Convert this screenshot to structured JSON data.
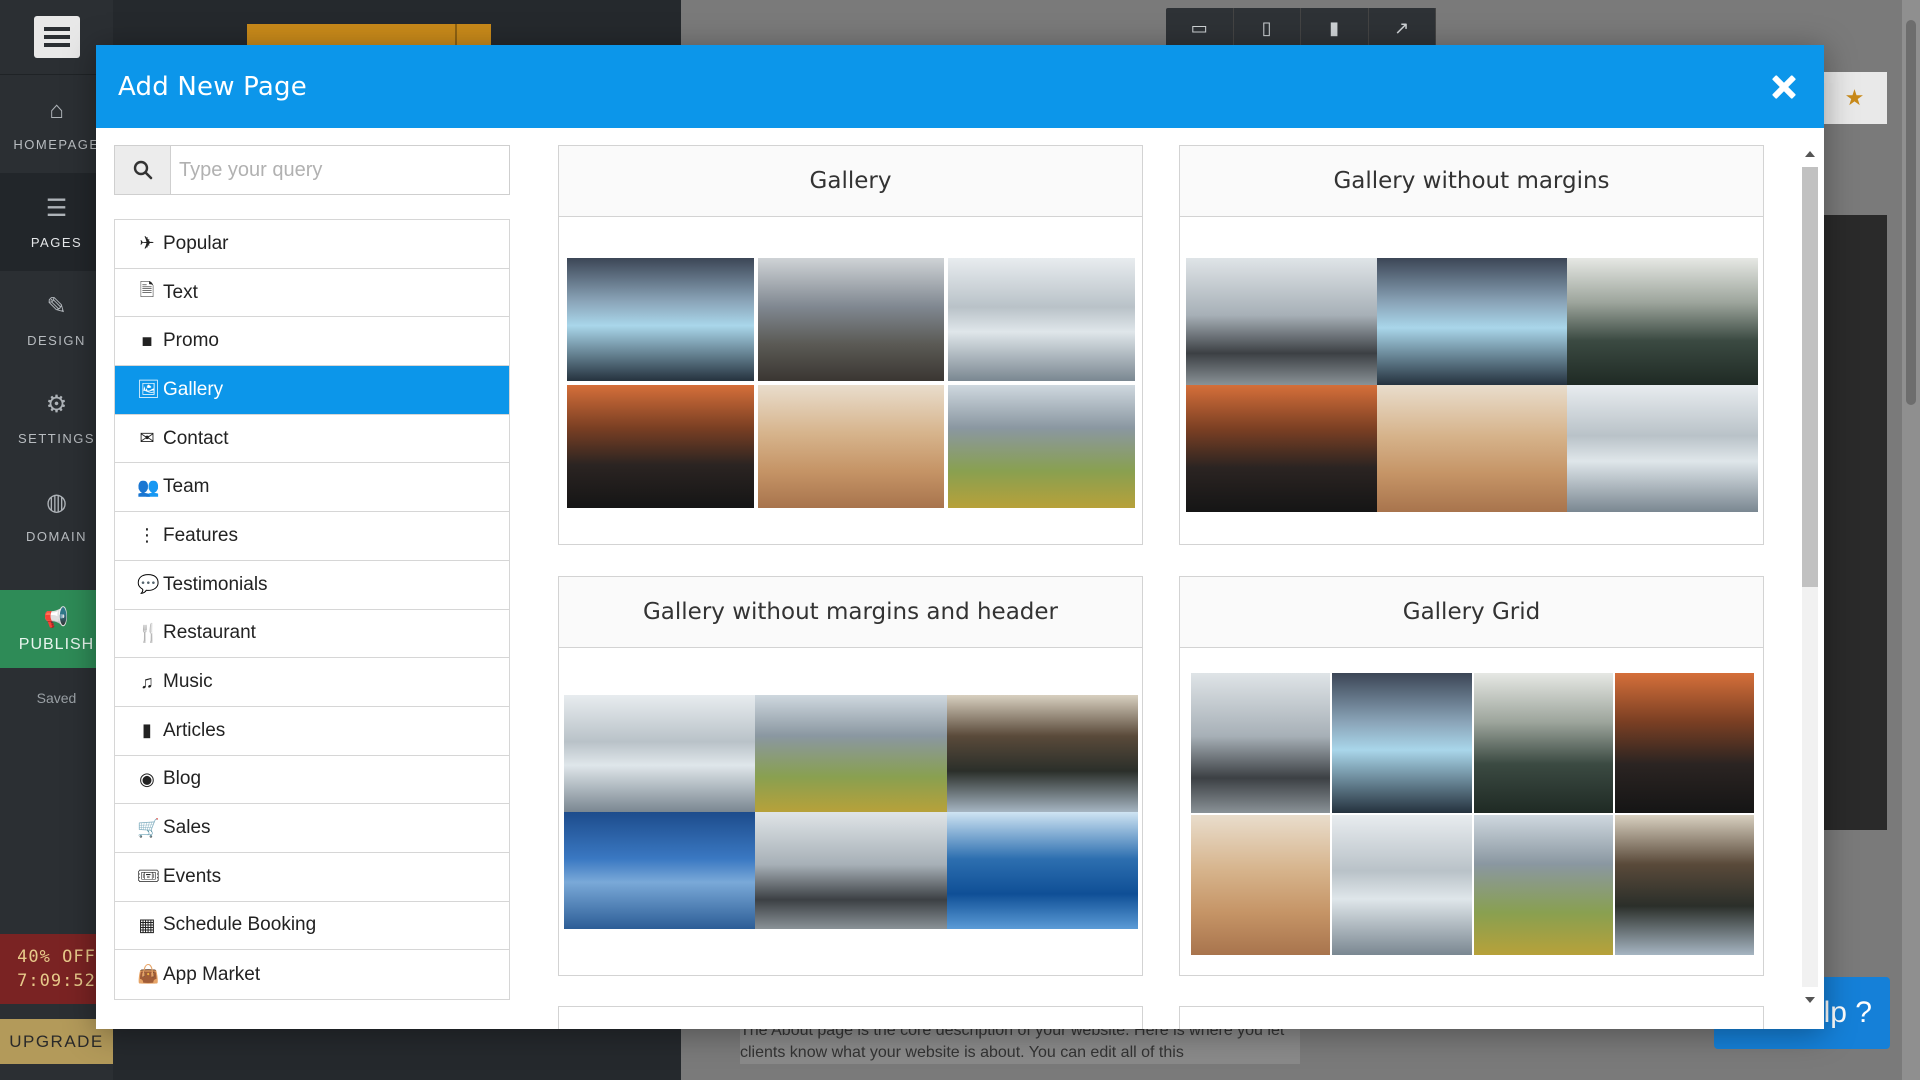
{
  "app": {
    "nav": [
      {
        "label": "HOMEPAGE",
        "icon": "home-icon"
      },
      {
        "label": "PAGES",
        "icon": "pages-icon"
      },
      {
        "label": "DESIGN",
        "icon": "brush-icon"
      },
      {
        "label": "SETTINGS",
        "icon": "gear-icon"
      },
      {
        "label": "DOMAIN",
        "icon": "globe-icon"
      }
    ],
    "publish_label": "PUBLISH",
    "saved_label": "Saved",
    "promo_discount": "40% OFF",
    "promo_timer": "7:09:52",
    "upgrade_label": "UPGRADE",
    "help_label": "elp ?",
    "site_text": "The About page is the core description of your website. Here is where you let clients know what your website is about. You can edit all of this"
  },
  "modal": {
    "title": "Add New Page",
    "search_placeholder": "Type your query",
    "categories": [
      {
        "label": "Popular",
        "icon": "rocket-icon"
      },
      {
        "label": "Text",
        "icon": "document-icon"
      },
      {
        "label": "Promo",
        "icon": "square-icon"
      },
      {
        "label": "Gallery",
        "icon": "image-icon",
        "active": true
      },
      {
        "label": "Contact",
        "icon": "envelope-icon"
      },
      {
        "label": "Team",
        "icon": "users-icon"
      },
      {
        "label": "Features",
        "icon": "ellipsis-vertical-icon"
      },
      {
        "label": "Testimonials",
        "icon": "comments-icon"
      },
      {
        "label": "Restaurant",
        "icon": "cutlery-icon"
      },
      {
        "label": "Music",
        "icon": "music-icon"
      },
      {
        "label": "Articles",
        "icon": "file-icon"
      },
      {
        "label": "Blog",
        "icon": "rss-icon"
      },
      {
        "label": "Sales",
        "icon": "cart-icon"
      },
      {
        "label": "Events",
        "icon": "ticket-icon"
      },
      {
        "label": "Schedule Booking",
        "icon": "calendar-icon"
      },
      {
        "label": "App Market",
        "icon": "shopping-bag-icon"
      }
    ],
    "templates": [
      {
        "title": "Gallery"
      },
      {
        "title": "Gallery without margins"
      },
      {
        "title": "Gallery without margins and header"
      },
      {
        "title": "Gallery Grid"
      }
    ]
  },
  "colors": {
    "accent": "#0c96ea",
    "publish": "#2e8b57",
    "promo": "#7a2323",
    "upgrade": "#b39a5a",
    "nav_bg": "#2b2f33"
  }
}
